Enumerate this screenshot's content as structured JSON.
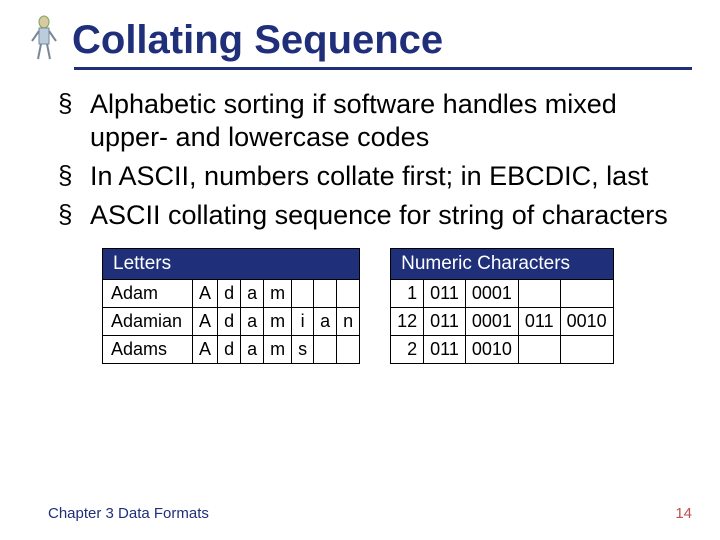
{
  "title": "Collating Sequence",
  "bullets": [
    "Alphabetic sorting if software handles mixed upper- and lowercase codes",
    "In ASCII, numbers collate first; in EBCDIC, last",
    "ASCII collating sequence for string of characters"
  ],
  "letters_table": {
    "header": "Letters",
    "rows": [
      {
        "name": "Adam",
        "cells": [
          "A",
          "d",
          "a",
          "m",
          "",
          "",
          ""
        ]
      },
      {
        "name": "Adamian",
        "cells": [
          "A",
          "d",
          "a",
          "m",
          "i",
          "a",
          "n"
        ]
      },
      {
        "name": "Adams",
        "cells": [
          "A",
          "d",
          "a",
          "m",
          "s",
          "",
          ""
        ]
      }
    ]
  },
  "numeric_table": {
    "header": "Numeric Characters",
    "rows": [
      {
        "num": "1",
        "cells": [
          "011",
          "0001",
          "",
          ""
        ]
      },
      {
        "num": "12",
        "cells": [
          "011",
          "0001",
          "011",
          "0010"
        ]
      },
      {
        "num": "2",
        "cells": [
          "011",
          "0010",
          "",
          ""
        ]
      }
    ]
  },
  "footer": {
    "chapter": "Chapter 3 Data Formats",
    "page": "14"
  }
}
